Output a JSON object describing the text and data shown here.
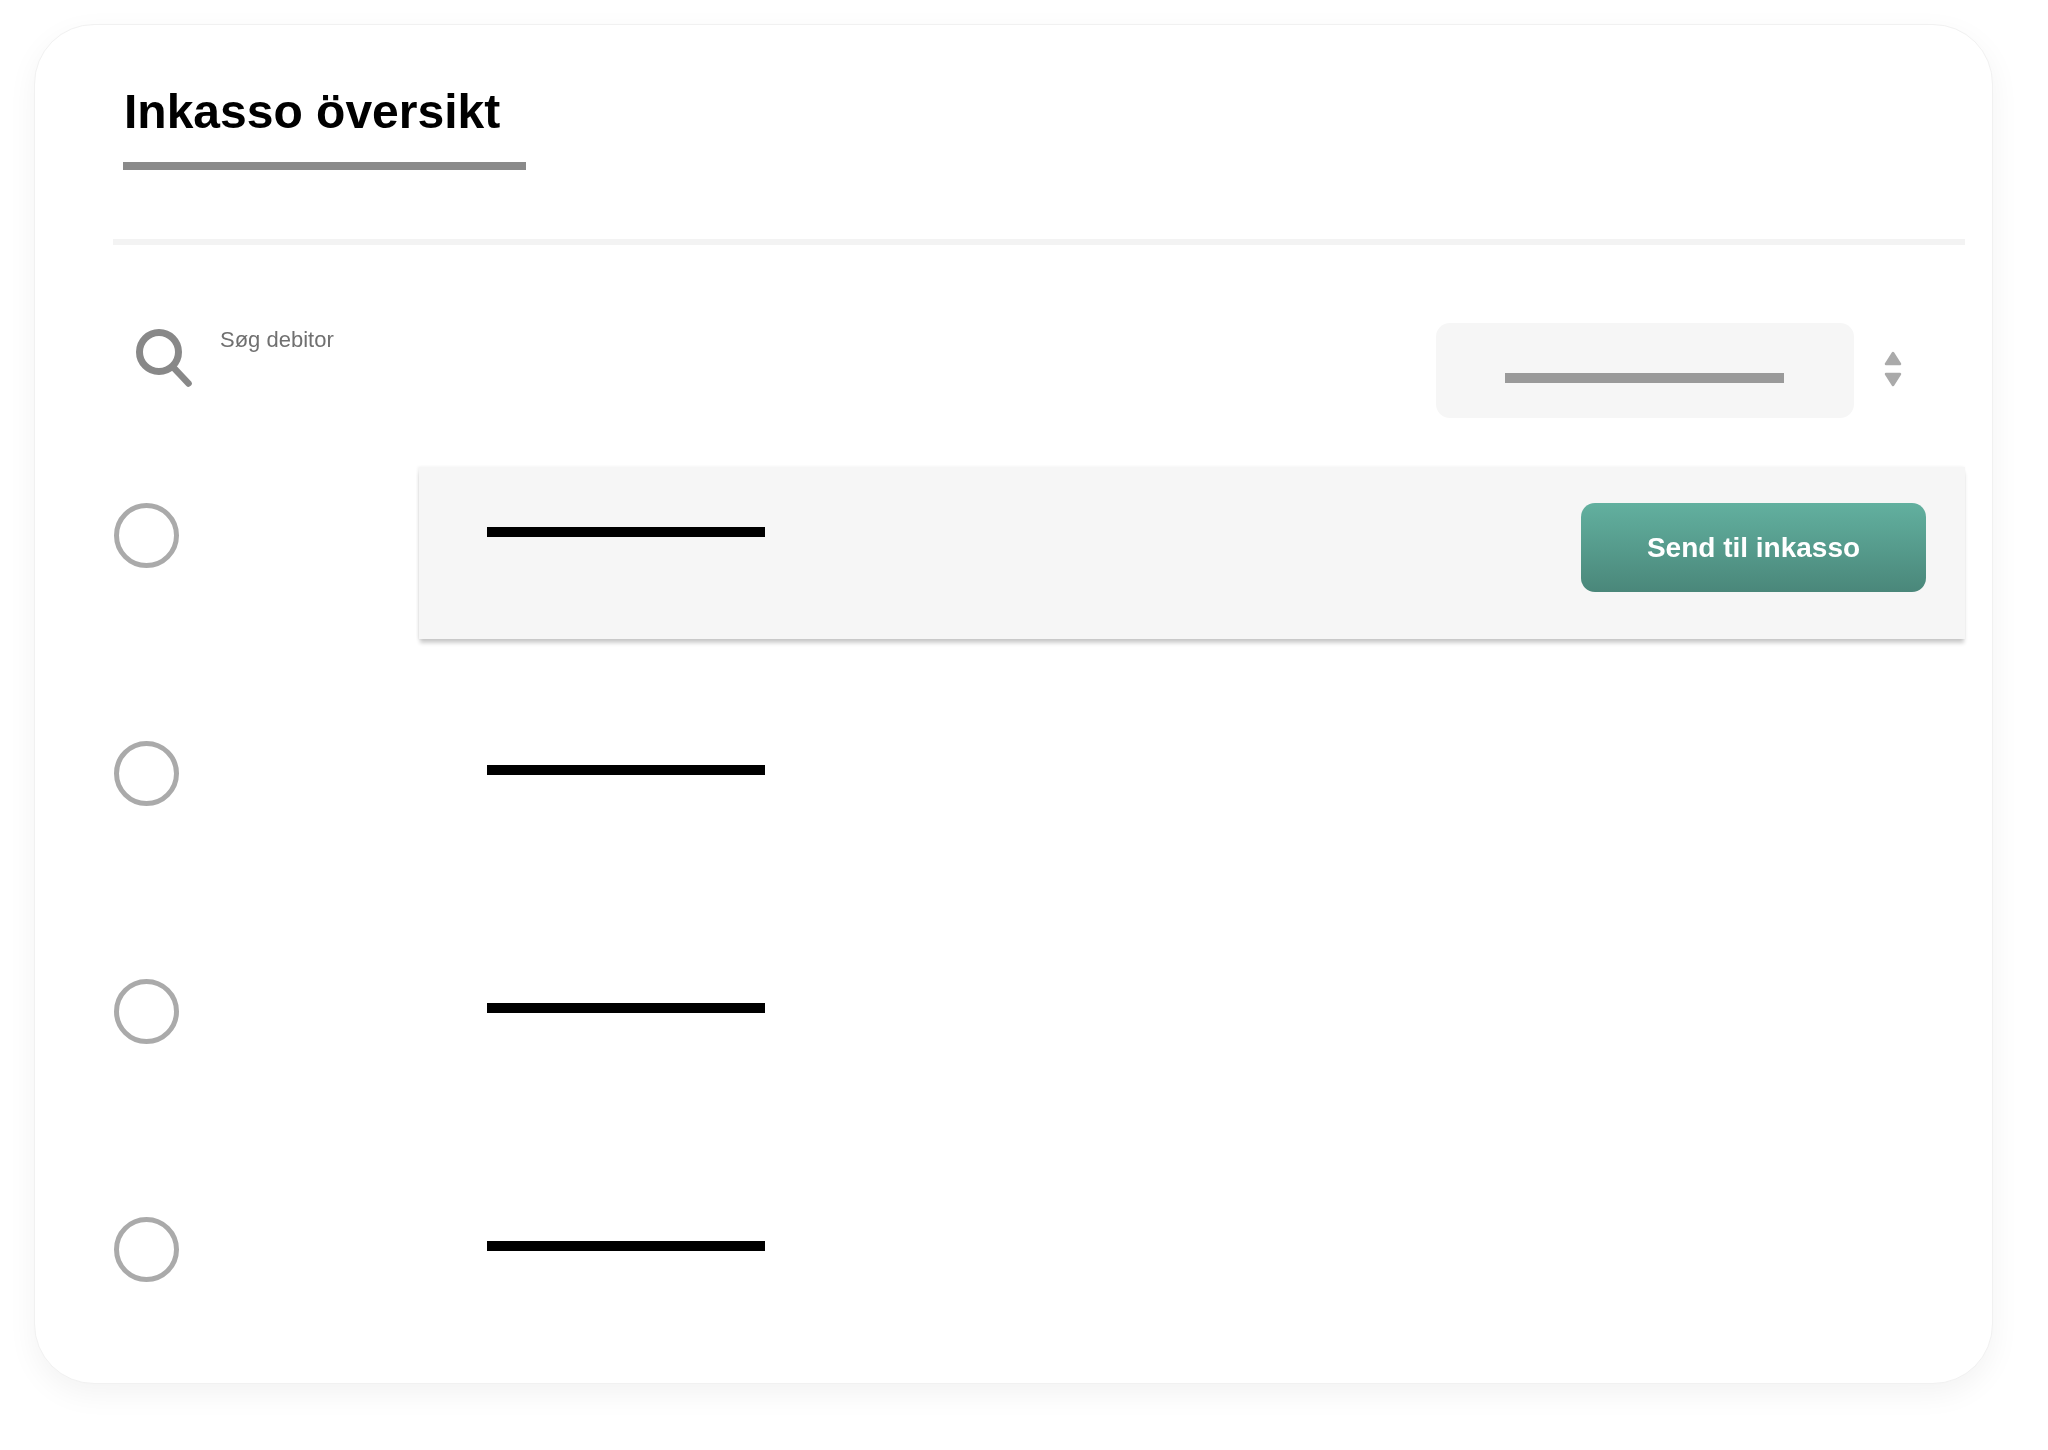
{
  "title": "Inkasso översikt",
  "search": {
    "placeholder": "Søg debitor"
  },
  "rows": [
    {
      "selected": true,
      "checked": false,
      "action": "Send til inkasso"
    },
    {
      "selected": false,
      "checked": false
    },
    {
      "selected": false,
      "checked": false
    },
    {
      "selected": false,
      "checked": false
    }
  ]
}
